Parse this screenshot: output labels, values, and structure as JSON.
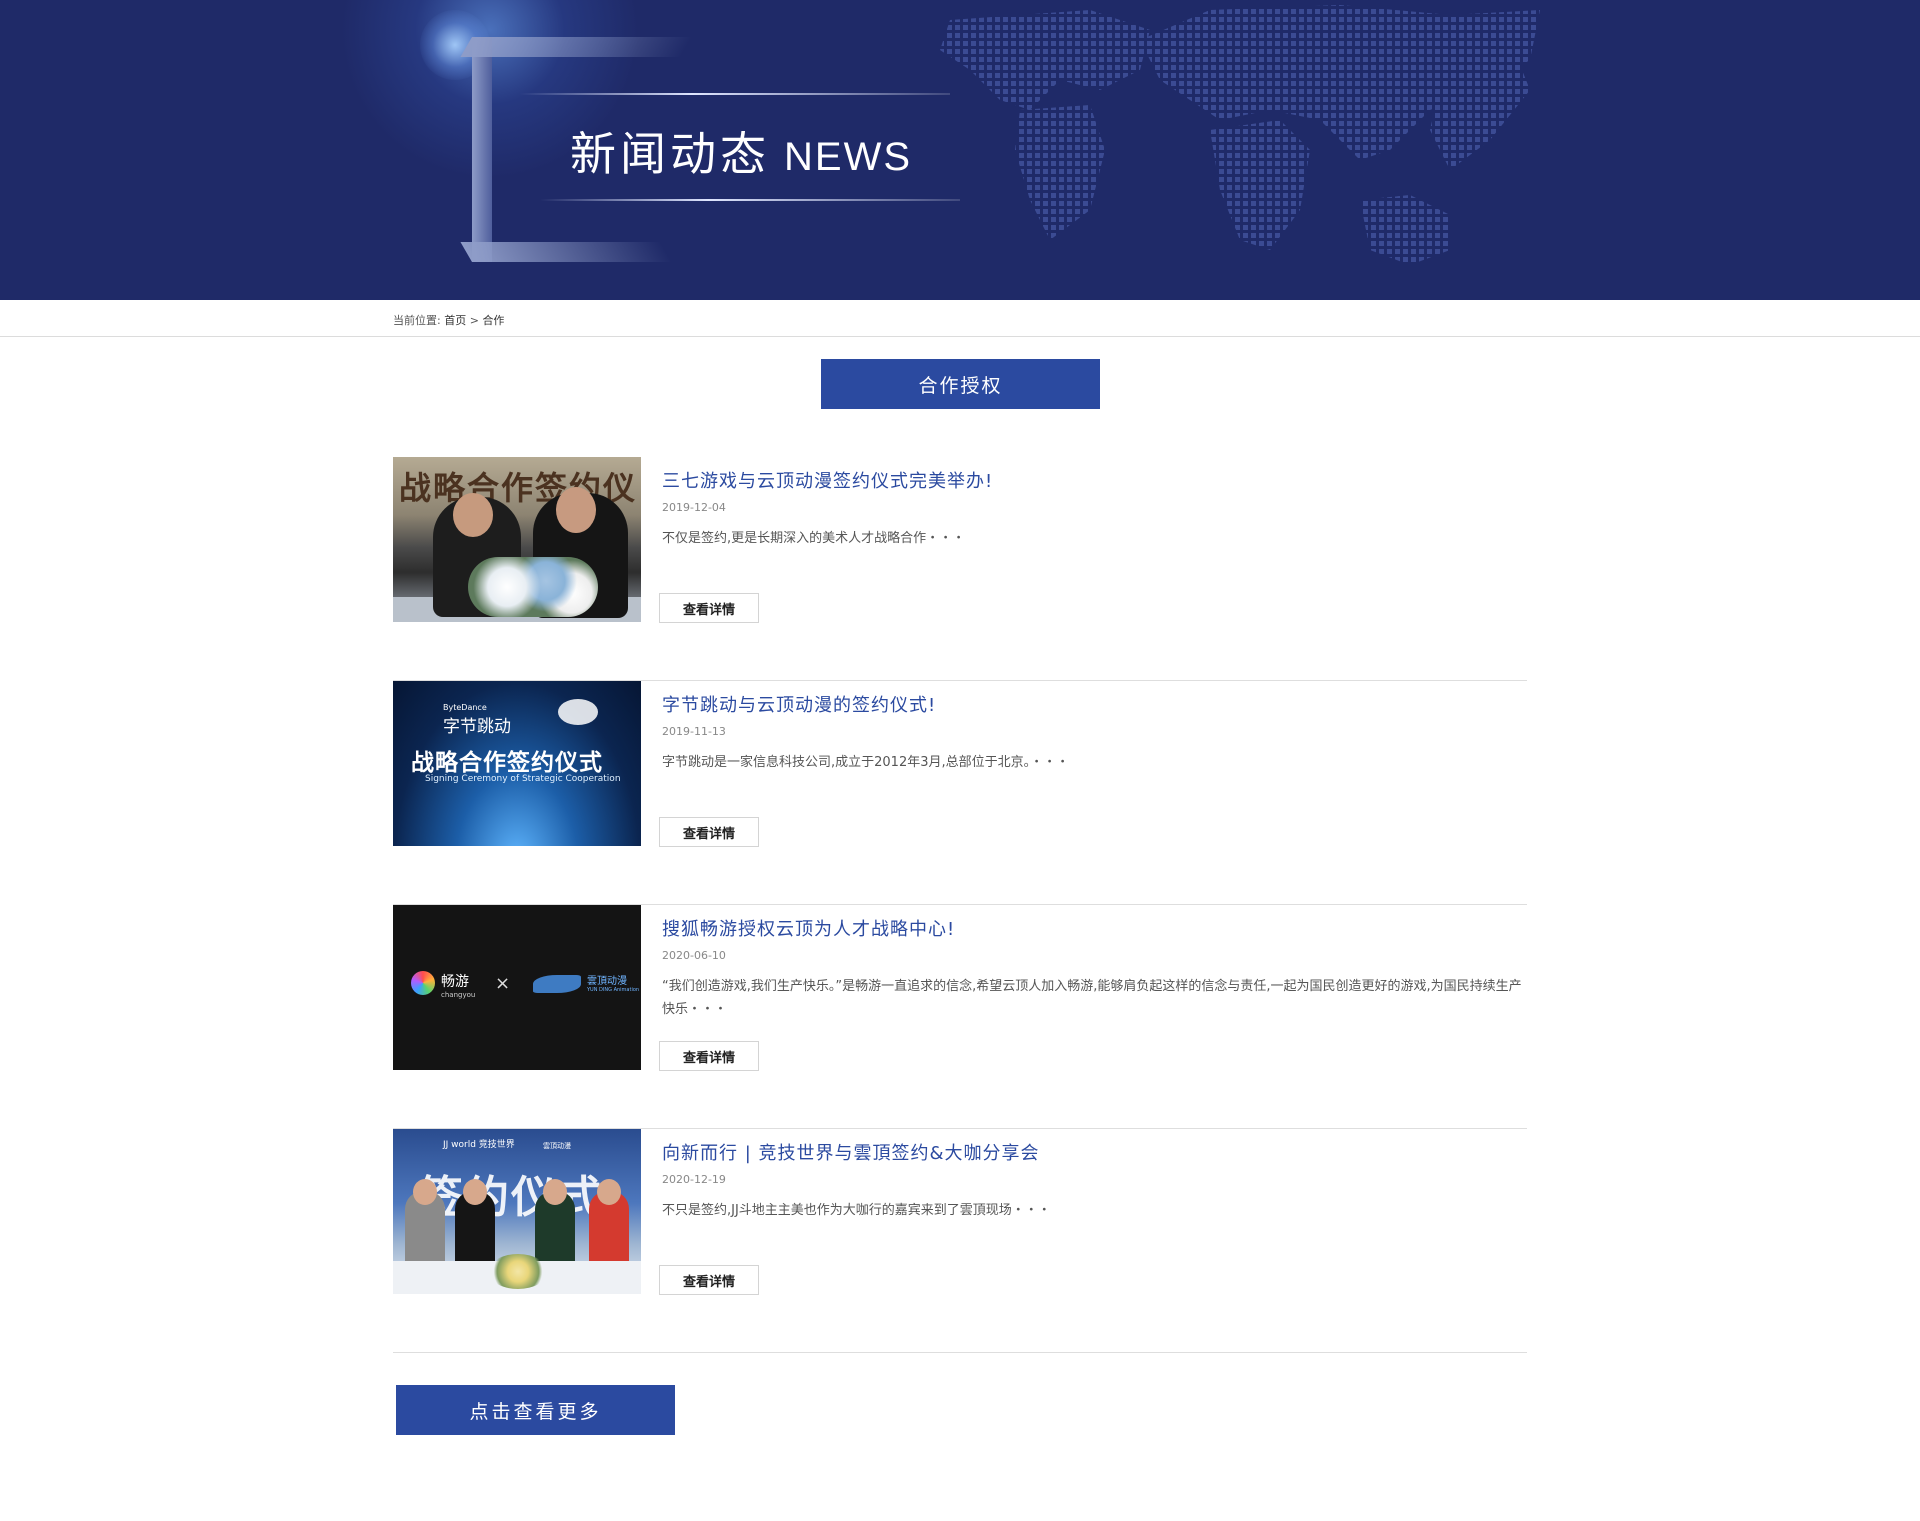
{
  "banner": {
    "title_cn": "新闻动态",
    "title_en": "NEWS",
    "background_color": "#1f2a68"
  },
  "breadcrumb": {
    "label": "当前位置:",
    "home": "首页",
    "separator": ">",
    "current": "合作"
  },
  "section": {
    "button_label": "合作授权",
    "accent_color": "#2b4aa0"
  },
  "news": [
    {
      "title": "三七游戏与云顶动漫签约仪式完美举办!",
      "date": "2019-12-04",
      "desc": "不仅是签约,更是长期深入的美术人才战略合作・・・",
      "more": "查看详情",
      "thumb": {
        "banner_text": "战略合作签约仪"
      }
    },
    {
      "title": "字节跳动与云顶动漫的签约仪式!",
      "date": "2019-11-13",
      "desc": "字节跳动是一家信息科技公司,成立于2012年3月,总部位于北京。・・・",
      "more": "查看详情",
      "thumb": {
        "brand_en": "ByteDance",
        "brand_cn": "字节跳动",
        "main": "战略合作签约仪式",
        "sub": "Signing Ceremony of Strategic Cooperation"
      }
    },
    {
      "title": "搜狐畅游授权云顶为人才战略中心!",
      "date": "2020-06-10",
      "desc": "“我们创造游戏,我们生产快乐。”是畅游一直追求的信念,希望云顶人加入畅游,能够肩负起这样的信念与责任,一起为国民创造更好的游戏,为国民持续生产快乐・・・",
      "more": "查看详情",
      "thumb": {
        "left_cn": "畅游",
        "left_en": "changyou",
        "times": "×",
        "right_cn": "雲頂动漫",
        "right_en": "YUN DING Animation"
      }
    },
    {
      "title": "向新而行 | 竞技世界与雲頂签约&大咖分享会",
      "date": "2020-12-19",
      "desc": "不只是签约,JJ斗地主主美也作为大咖行的嘉宾来到了雲頂现场・・・",
      "more": "查看详情",
      "thumb": {
        "hdr": "JJ world 竞技世界",
        "hdr2": "雲頂动漫",
        "big": "签约仪式"
      }
    }
  ],
  "load_more": {
    "label": "点击查看更多"
  }
}
